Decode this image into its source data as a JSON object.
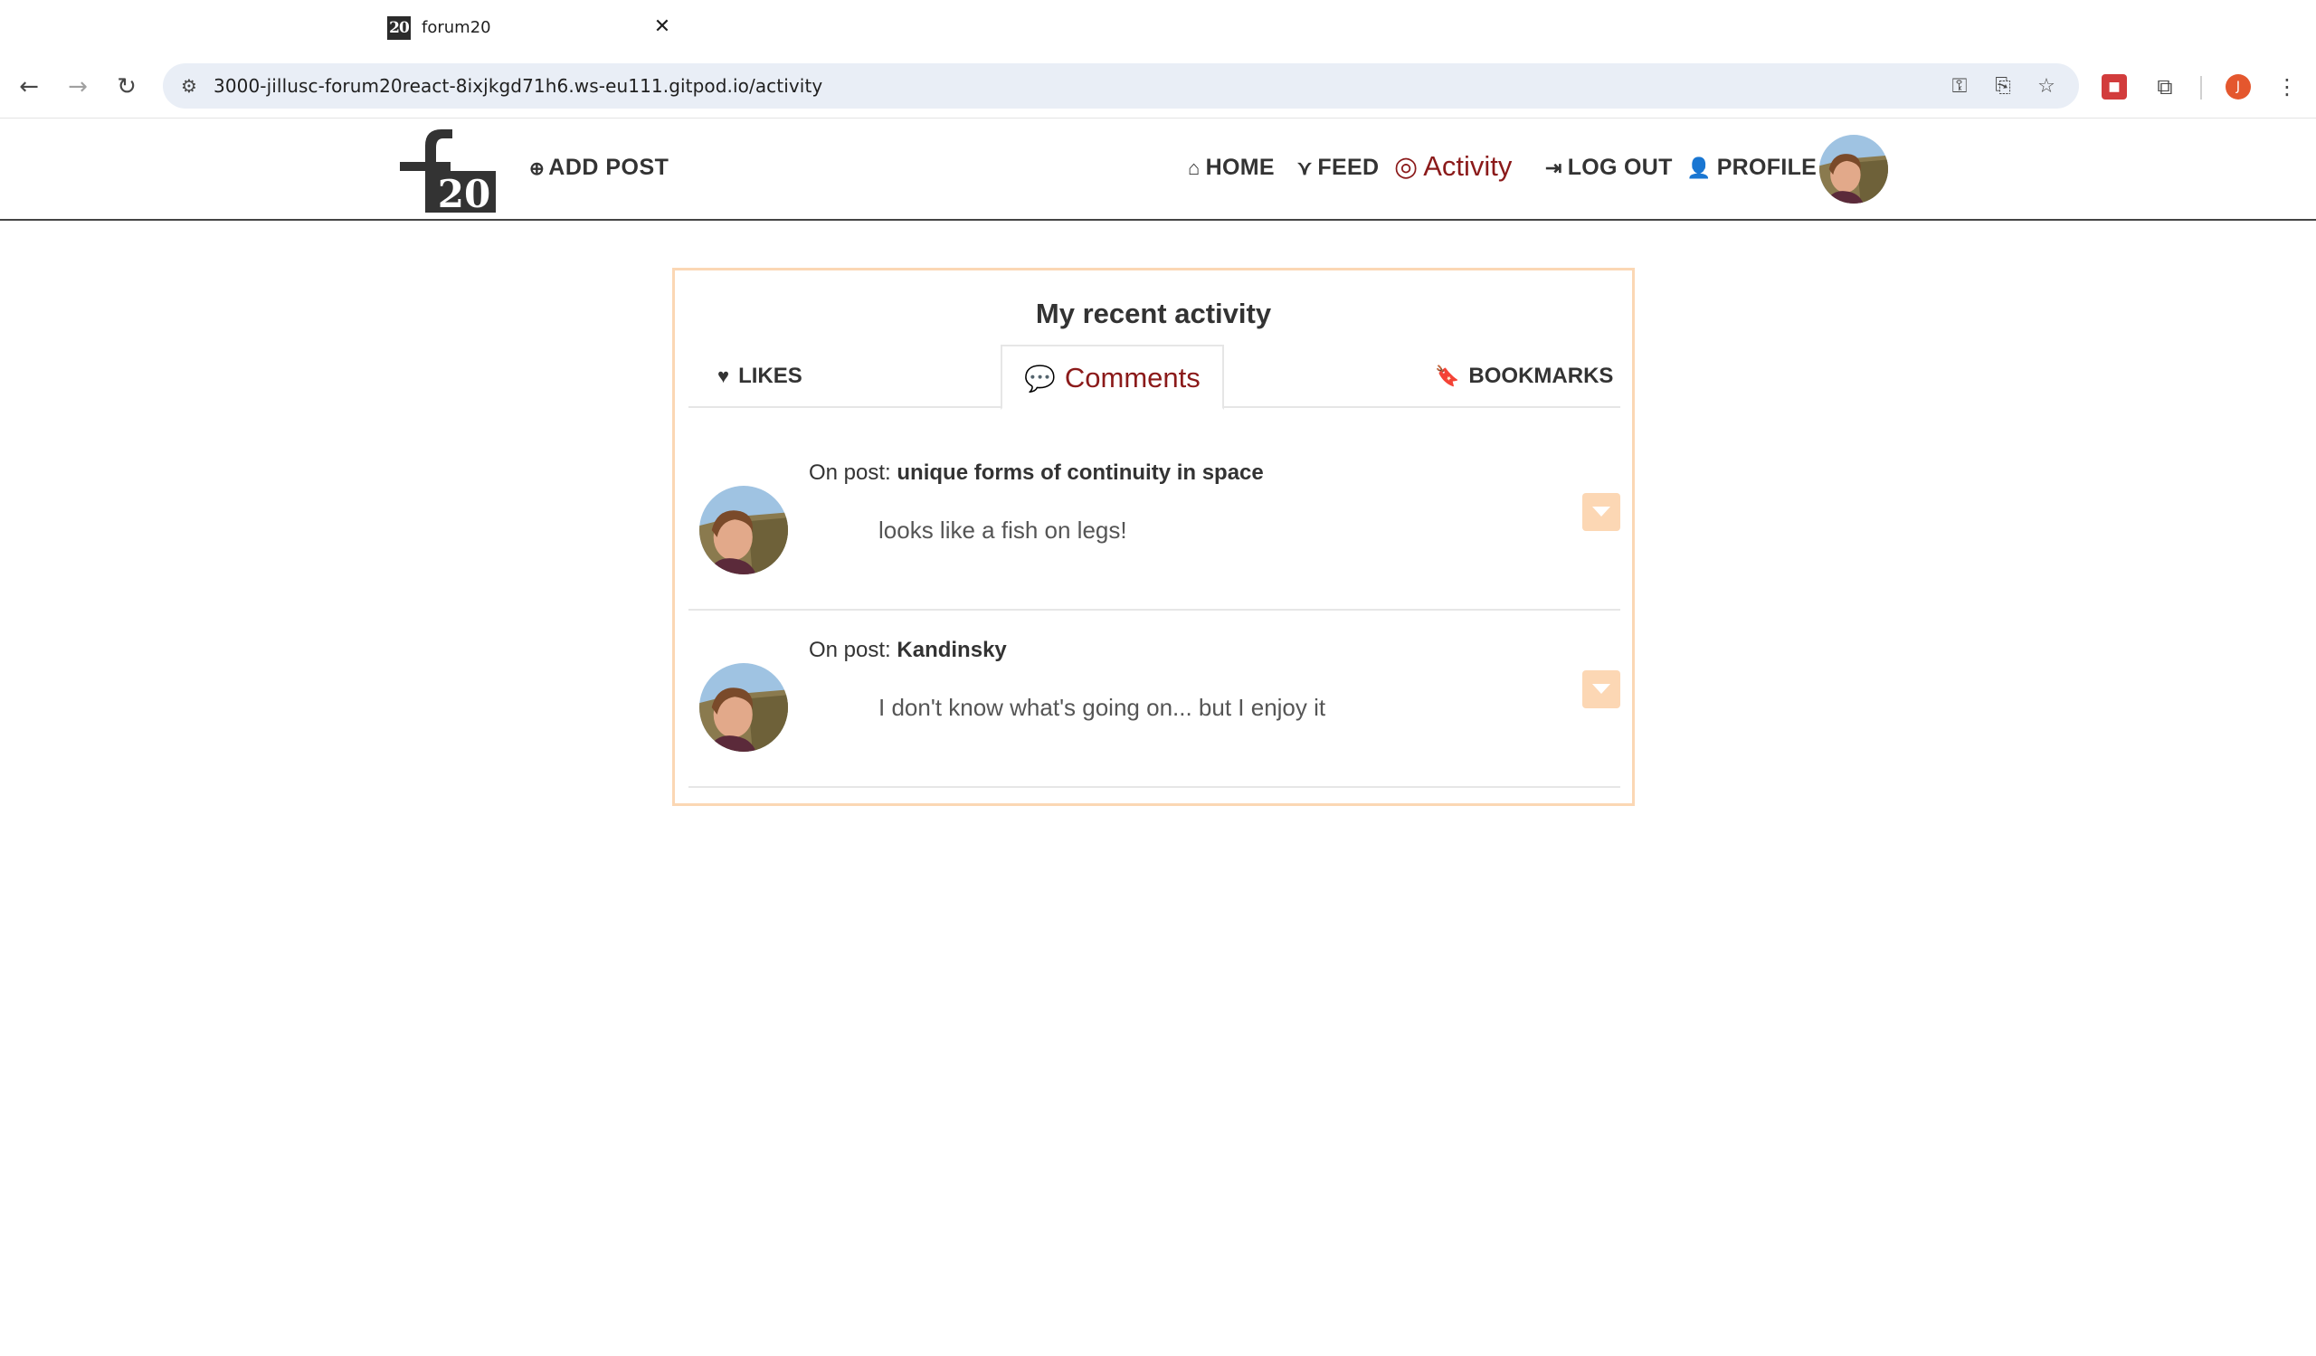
{
  "browser": {
    "tab_title": "forum20",
    "tab_favicon_text": "20",
    "url": "3000-jillusc-forum20react-8ixjkgd71h6.ws-eu111.gitpod.io/activity",
    "profile_initial": "J"
  },
  "navbar": {
    "add_post": "ADD POST",
    "links": {
      "home": "HOME",
      "feed": "FEED",
      "activity": "Activity",
      "logout": "LOG OUT",
      "profile": "PROFILE"
    },
    "logo_letters": "f20"
  },
  "activity": {
    "title": "My recent activity",
    "tabs": {
      "likes": "LIKES",
      "comments": "Comments",
      "bookmarks": "BOOKMARKS"
    },
    "active_tab": "Comments",
    "items": [
      {
        "prefix": "On post:",
        "post_title": "unique forms of continuity in space",
        "comment": "looks like a fish on legs!"
      },
      {
        "prefix": "On post:",
        "post_title": "Kandinsky",
        "comment": "I don't know what's going on... but I enjoy it"
      }
    ]
  },
  "colors": {
    "accent": "#8b1a1a",
    "card_border": "#fbd7b4",
    "toggle_bg": "#fcd7b4"
  }
}
